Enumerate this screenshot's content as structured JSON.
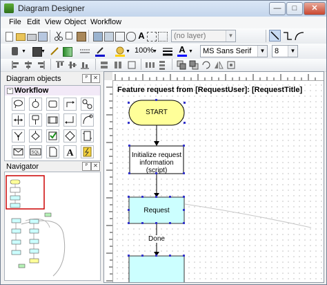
{
  "window": {
    "title": "Diagram Designer",
    "minimize_glyph": "—",
    "maximize_glyph": "□",
    "close_glyph": "✕"
  },
  "menu": [
    "File",
    "Edit",
    "View",
    "Object",
    "Workflow"
  ],
  "toolbar": {
    "layer_combo": "(no layer)",
    "zoom": "100%",
    "font_name": "MS Sans Serif",
    "font_size": "8"
  },
  "panels": {
    "objects_title": "Diagram objects",
    "workflow_group": "Workflow",
    "workflow_collapse_glyph": "−",
    "navigator_title": "Navigator",
    "pin_glyph": "ᴾ",
    "close_glyph": "✕"
  },
  "diagram": {
    "title": "Feature request from [RequestUser]: [RequestTitle]",
    "nodes": [
      {
        "id": "start",
        "label": "START"
      },
      {
        "id": "init",
        "label": "Initialize request information (script)"
      },
      {
        "id": "request",
        "label": "Request"
      }
    ],
    "edge_label": "Done"
  },
  "colors": {
    "start_fill": "#ffff99",
    "request_fill": "#ccffff",
    "selection_handle": "#3333cc",
    "navigator_frame": "#cc0000"
  }
}
